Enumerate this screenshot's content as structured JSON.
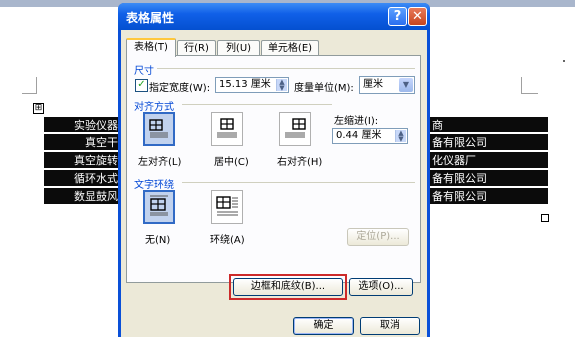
{
  "document": {
    "left_rows": [
      "实验仪器",
      "真空干",
      "真空旋转",
      "循环水式",
      "数显鼓风"
    ],
    "right_rows": [
      "商",
      "备有限公司",
      "化仪器厂",
      "备有限公司",
      "备有限公司"
    ],
    "move_handle_glyph": "⊞"
  },
  "dialog": {
    "title": "表格属性",
    "help_glyph": "?",
    "close_glyph": "✕",
    "tabs": [
      "表格(T)",
      "行(R)",
      "列(U)",
      "单元格(E)"
    ],
    "size": {
      "section_title": "尺寸",
      "specify_width_checked": true,
      "check_glyph": "✓",
      "specify_width_label": "指定宽度(W):",
      "width_value": "15.13 厘米",
      "measure_label": "度量单位(M):",
      "measure_value": "厘米"
    },
    "alignment": {
      "section_title": "对齐方式",
      "options": [
        "左对齐(L)",
        "居中(C)",
        "右对齐(H)"
      ],
      "selected": 0,
      "indent_label": "左缩进(I):",
      "indent_value": "0.44 厘米"
    },
    "wrapping": {
      "section_title": "文字环绕",
      "options": [
        "无(N)",
        "环绕(A)"
      ],
      "selected": 0,
      "position_button": "定位(P)..."
    },
    "buttons": {
      "borders": "边框和底纹(B)...",
      "options": "选项(O)...",
      "ok": "确定",
      "cancel": "取消"
    }
  },
  "colors": {
    "titlebar": "#0a50d8",
    "section_text": "#0046d5",
    "highlight": "#cc2a2a",
    "selected_icon": "#316ac5"
  }
}
